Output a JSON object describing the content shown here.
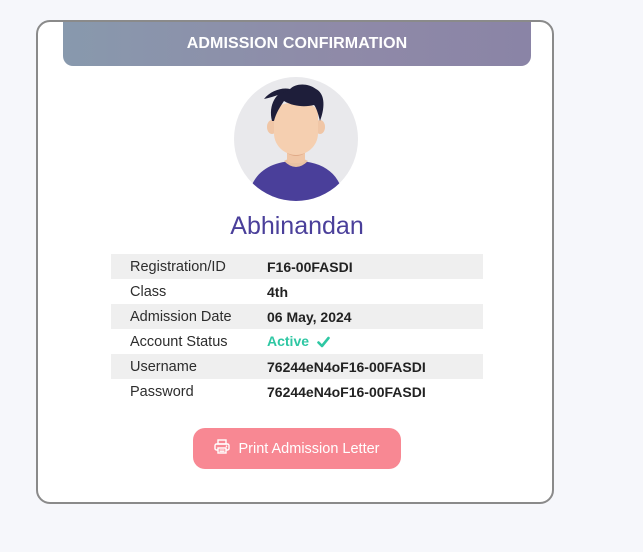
{
  "header": {
    "title": "ADMISSION CONFIRMATION"
  },
  "student": {
    "name": "Abhinandan",
    "avatar_icon": "student-avatar-icon"
  },
  "details": [
    {
      "label": "Registration/ID",
      "value": "F16-00FASDI"
    },
    {
      "label": "Class",
      "value": "4th"
    },
    {
      "label": "Admission Date",
      "value": "06 May, 2024"
    },
    {
      "label": "Account Status",
      "value": "Active",
      "status_icon": "check-icon"
    },
    {
      "label": "Username",
      "value": "76244eN4oF16-00FASDI"
    },
    {
      "label": "Password",
      "value": "76244eN4oF16-00FASDI"
    }
  ],
  "actions": {
    "print_label": "Print Admission Letter",
    "print_icon": "printer-icon"
  },
  "colors": {
    "accent_name": "#4a3f9a",
    "status_active": "#2ec7a3",
    "button_bg": "#f88893",
    "header_bg_start": "#8899ad",
    "header_bg_end": "#8a84a6"
  }
}
